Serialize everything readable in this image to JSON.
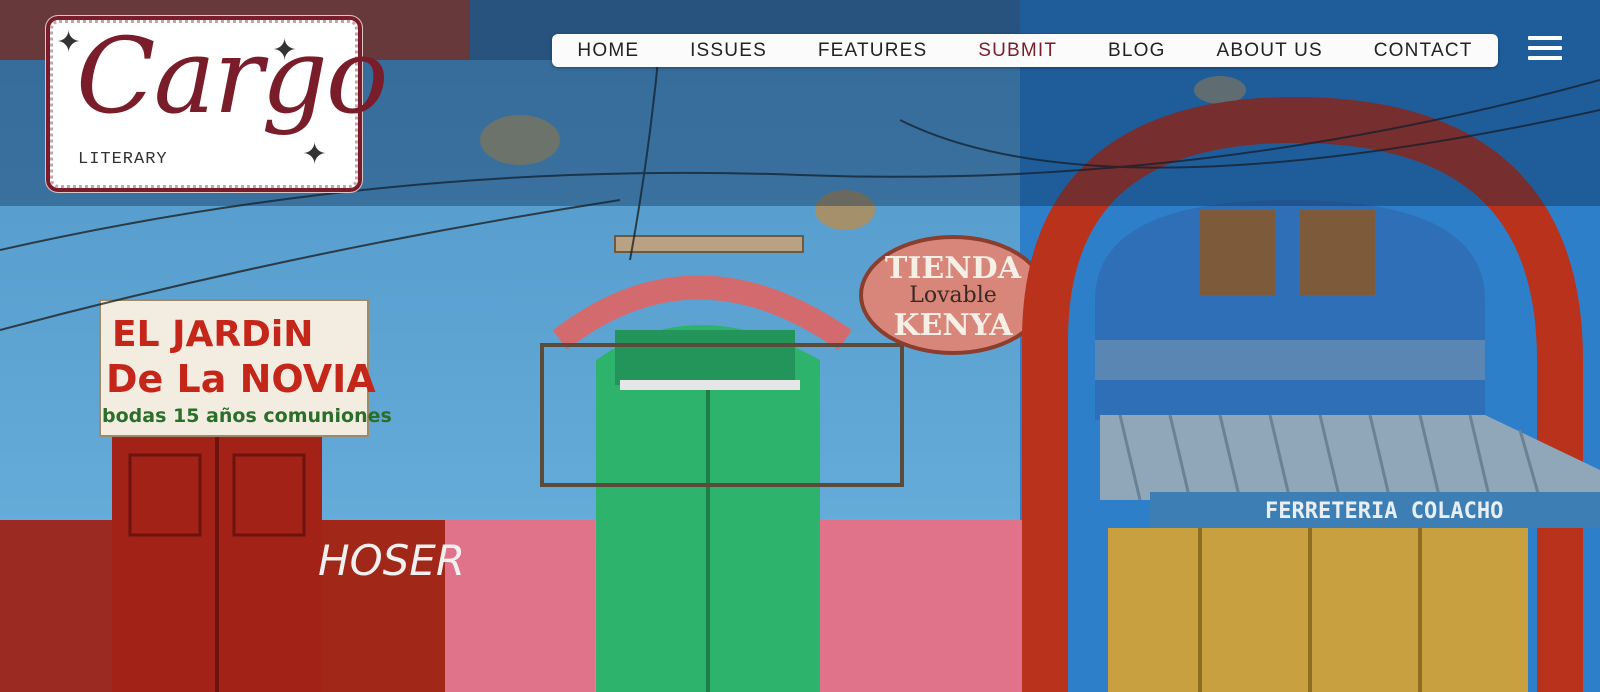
{
  "logo": {
    "script_text": "Cargo",
    "subtitle": "LITERARY",
    "colors": {
      "ink": "#7a1d2a",
      "card": "#ffffff"
    }
  },
  "nav": {
    "items": [
      {
        "label": "HOME"
      },
      {
        "label": "ISSUES"
      },
      {
        "label": "FEATURES"
      },
      {
        "label": "SUBMIT",
        "active": true
      },
      {
        "label": "BLOG"
      },
      {
        "label": "ABOUT US"
      },
      {
        "label": "CONTACT"
      }
    ],
    "active_color": "#7a1d2a",
    "menu_icon": "hamburger-menu-icon"
  },
  "hero": {
    "signs": {
      "jardin": [
        "EL JARDiN",
        "De La NOVIA",
        "bodas 15 años comuniones"
      ],
      "tienda": [
        "TIENDA",
        "Lovable",
        "KENYA"
      ],
      "ferreteria": "FERRETERIA COLACHO",
      "graffiti": "HOSER"
    },
    "colors": {
      "wall_blue": "#5aa6d6",
      "wall_pink": "#e07a8c",
      "door_red": "#a32218",
      "door_green": "#2db36b",
      "arch_red": "#b8321c",
      "shutter_blue": "#2f6fb8",
      "door_gold": "#c9a040"
    }
  }
}
